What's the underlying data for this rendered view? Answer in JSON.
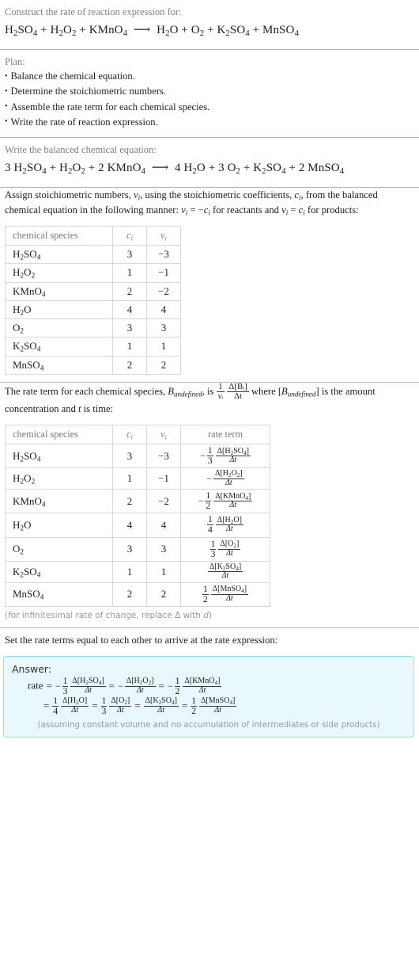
{
  "header": {
    "prompt": "Construct the rate of reaction expression for:",
    "equation": {
      "reactants": [
        "H_2SO_4",
        "H_2O_2",
        "KMnO_4"
      ],
      "products": [
        "H_2O",
        "O_2",
        "K_2SO_4",
        "MnSO_4"
      ],
      "arrow": "⟶",
      "plain": "H2SO4 + H2O2 + KMnO4 ⟶ H2O + O2 + K2SO4 + MnSO4"
    }
  },
  "plan": {
    "title": "Plan:",
    "steps": [
      "Balance the chemical equation.",
      "Determine the stoichiometric numbers.",
      "Assemble the rate term for each chemical species.",
      "Write the rate of reaction expression."
    ]
  },
  "balanced": {
    "prompt": "Write the balanced chemical equation:",
    "plain": "3 H2SO4 + H2O2 + 2 KMnO4 ⟶ 4 H2O + 3 O2 + K2SO4 + 2 MnSO4",
    "reactant_coeffs": [
      "3",
      "",
      "2"
    ],
    "product_coeffs": [
      "4",
      "3",
      "",
      "2"
    ]
  },
  "stoich": {
    "intro_1": "Assign stoichiometric numbers, ",
    "intro_2": ", using the stoichiometric coefficients, ",
    "intro_3": ", from the balanced chemical equation in the following manner: ",
    "intro_4": " for reactants and ",
    "intro_5": " for products:",
    "sym_nu": "ν",
    "sym_c": "c",
    "sym_i": "i",
    "rel_reactants": "νᵢ = −cᵢ",
    "rel_products": "νᵢ = cᵢ",
    "columns": [
      "chemical species",
      "c",
      "ν"
    ],
    "rows": [
      {
        "species": "H_2SO_4",
        "c": "3",
        "nu": "−3"
      },
      {
        "species": "H_2O_2",
        "c": "1",
        "nu": "−1"
      },
      {
        "species": "KMnO_4",
        "c": "2",
        "nu": "−2"
      },
      {
        "species": "H_2O",
        "c": "4",
        "nu": "4"
      },
      {
        "species": "O_2",
        "c": "3",
        "nu": "3"
      },
      {
        "species": "K_2SO_4",
        "c": "1",
        "nu": "1"
      },
      {
        "species": "MnSO_4",
        "c": "2",
        "nu": "2"
      }
    ]
  },
  "rateterm": {
    "intro_1": "The rate term for each chemical species, ",
    "intro_2": ", is ",
    "intro_3": " where ",
    "intro_4": " is the amount concentration and ",
    "intro_5": " is time:",
    "sym_B": "B",
    "sym_t": "t",
    "formula_num": "1",
    "formula_den": "νᵢ",
    "formula_dnum": "Δ[Bᵢ]",
    "formula_dden": "Δt",
    "columns": [
      "chemical species",
      "c",
      "ν",
      "rate term"
    ],
    "rows": [
      {
        "species": "H_2SO_4",
        "c": "3",
        "nu": "−3",
        "sign": "−",
        "coef_num": "1",
        "coef_den": "3",
        "delta_num": "Δ[H_2SO_4]",
        "delta_den": "Δt"
      },
      {
        "species": "H_2O_2",
        "c": "1",
        "nu": "−1",
        "sign": "−",
        "coef_num": "",
        "coef_den": "",
        "delta_num": "Δ[H_2O_2]",
        "delta_den": "Δt"
      },
      {
        "species": "KMnO_4",
        "c": "2",
        "nu": "−2",
        "sign": "−",
        "coef_num": "1",
        "coef_den": "2",
        "delta_num": "Δ[KMnO_4]",
        "delta_den": "Δt"
      },
      {
        "species": "H_2O",
        "c": "4",
        "nu": "4",
        "sign": "",
        "coef_num": "1",
        "coef_den": "4",
        "delta_num": "Δ[H_2O]",
        "delta_den": "Δt"
      },
      {
        "species": "O_2",
        "c": "3",
        "nu": "3",
        "sign": "",
        "coef_num": "1",
        "coef_den": "3",
        "delta_num": "Δ[O_2]",
        "delta_den": "Δt"
      },
      {
        "species": "K_2SO_4",
        "c": "1",
        "nu": "1",
        "sign": "",
        "coef_num": "",
        "coef_den": "",
        "delta_num": "Δ[K_2SO_4]",
        "delta_den": "Δt"
      },
      {
        "species": "MnSO_4",
        "c": "2",
        "nu": "2",
        "sign": "",
        "coef_num": "1",
        "coef_den": "2",
        "delta_num": "Δ[MnSO_4]",
        "delta_den": "Δt"
      }
    ],
    "note": "(for infinitesimal rate of change, replace Δ with d)"
  },
  "final": {
    "prompt": "Set the rate terms equal to each other to arrive at the rate expression:",
    "answer_label": "Answer:",
    "rate_word": "rate",
    "terms": [
      {
        "sign": "−",
        "coef_num": "1",
        "coef_den": "3",
        "delta_num": "Δ[H_2SO_4]",
        "delta_den": "Δt"
      },
      {
        "sign": "−",
        "coef_num": "",
        "coef_den": "",
        "delta_num": "Δ[H_2O_2]",
        "delta_den": "Δt"
      },
      {
        "sign": "−",
        "coef_num": "1",
        "coef_den": "2",
        "delta_num": "Δ[KMnO_4]",
        "delta_den": "Δt"
      },
      {
        "sign": "",
        "coef_num": "1",
        "coef_den": "4",
        "delta_num": "Δ[H_2O]",
        "delta_den": "Δt"
      },
      {
        "sign": "",
        "coef_num": "1",
        "coef_den": "3",
        "delta_num": "Δ[O_2]",
        "delta_den": "Δt"
      },
      {
        "sign": "",
        "coef_num": "",
        "coef_den": "",
        "delta_num": "Δ[K_2SO_4]",
        "delta_den": "Δt"
      },
      {
        "sign": "",
        "coef_num": "1",
        "coef_den": "2",
        "delta_num": "Δ[MnSO_4]",
        "delta_den": "Δt"
      }
    ],
    "note": "(assuming constant volume and no accumulation of intermediates or side products)"
  },
  "colors": {
    "answer_bg": "#e8f8fc",
    "answer_border": "#9fd9ea",
    "divider": "#b3b3b3",
    "muted_text": "#808080",
    "text": "#202020"
  }
}
